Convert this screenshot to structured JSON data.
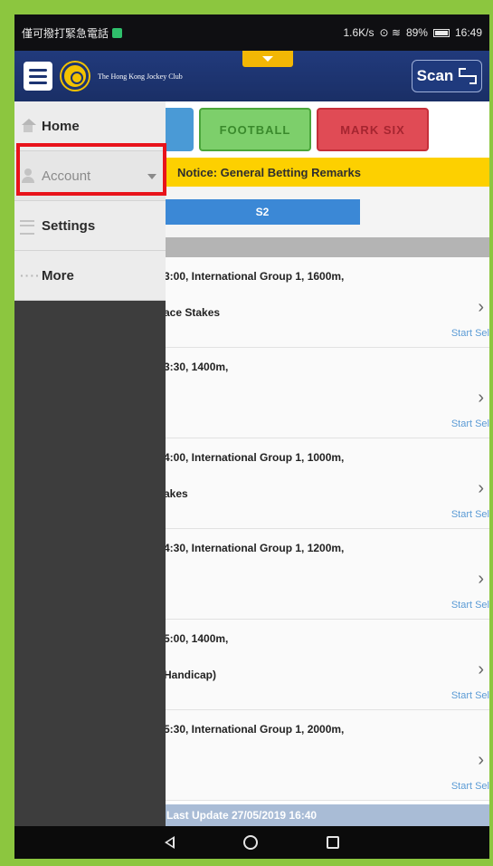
{
  "status_bar": {
    "left_text": "僅可撥打緊急電話",
    "right_text": "1.6K/s",
    "battery": "89%",
    "time": "16:49"
  },
  "header": {
    "club_name": "The Hong Kong Jockey Club",
    "scan_label": "Scan"
  },
  "tabs": {
    "football": "FOOTBALL",
    "mark_six": "MARK SIX"
  },
  "notice": {
    "text": "Notice: General Betting Remarks"
  },
  "race_selector": {
    "label": "S2"
  },
  "races": [
    {
      "line1": "3:00, International Group 1, 1600m,",
      "line2": "ace Stakes",
      "action": "Start Sel"
    },
    {
      "line1": "3:30, 1400m,",
      "line2": "",
      "action": "Start Sel"
    },
    {
      "line1": "4:00, International Group 1, 1000m,",
      "line2": "akes",
      "action": "Start Sel"
    },
    {
      "line1": "4:30, International Group 1, 1200m,",
      "line2": "",
      "action": "Start Sel"
    },
    {
      "line1": "5:00, 1400m,",
      "line2": "Handicap)",
      "action": "Start Sel"
    },
    {
      "line1": "5:30, International Group 1, 2000m,",
      "line2": "",
      "action": "Start Sel"
    }
  ],
  "last_update": "Last Update 27/05/2019 16:40",
  "drawer": {
    "items": [
      {
        "label": "Home",
        "icon": "home-icon"
      },
      {
        "label": "Account",
        "icon": "user-icon"
      },
      {
        "label": "Settings",
        "icon": "settings-icon"
      },
      {
        "label": "More",
        "icon": "more-icon"
      }
    ]
  },
  "colors": {
    "frame": "#8cc63f",
    "header": "#1c3472",
    "notice": "#fdd000",
    "highlight": "#e8131b",
    "link": "#5b9bd5"
  }
}
